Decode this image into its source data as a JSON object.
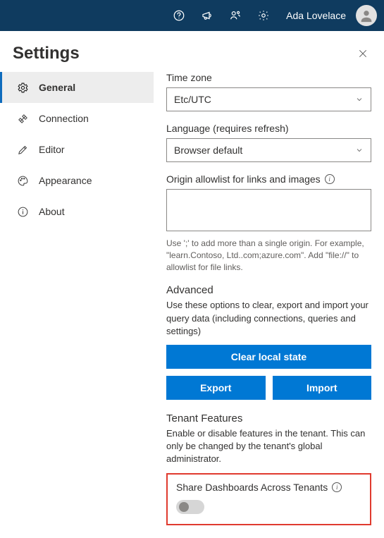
{
  "topbar": {
    "username": "Ada Lovelace"
  },
  "panel": {
    "title": "Settings"
  },
  "sidebar": {
    "items": [
      {
        "label": "General"
      },
      {
        "label": "Connection"
      },
      {
        "label": "Editor"
      },
      {
        "label": "Appearance"
      },
      {
        "label": "About"
      }
    ]
  },
  "timezone": {
    "label": "Time zone",
    "value": "Etc/UTC"
  },
  "language": {
    "label": "Language (requires refresh)",
    "value": "Browser default"
  },
  "origin": {
    "label": "Origin allowlist for links and images",
    "value": "",
    "helper": "Use ';' to add more than a single origin. For example, \"learn.Contoso, Ltd..com;azure.com\". Add \"file://\" to allowlist for file links."
  },
  "advanced": {
    "title": "Advanced",
    "desc": "Use these options to clear, export and import your query data (including connections, queries and settings)",
    "clear_label": "Clear local state",
    "export_label": "Export",
    "import_label": "Import"
  },
  "tenant": {
    "title": "Tenant Features",
    "desc": "Enable or disable features in the tenant. This can only be changed by the tenant's global administrator.",
    "share_label": "Share Dashboards Across Tenants",
    "share_enabled": false
  }
}
